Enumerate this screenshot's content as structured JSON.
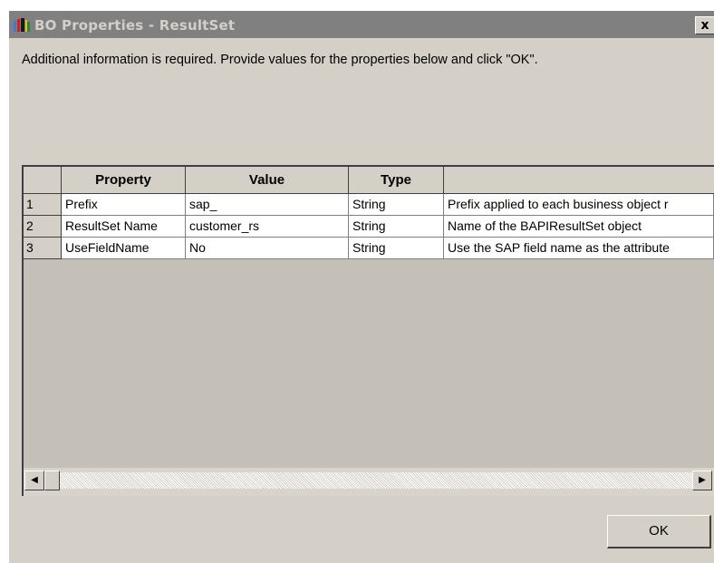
{
  "window": {
    "title": "BO Properties - ResultSet",
    "close_label": "x"
  },
  "instructions": "Additional information is required. Provide values for the properties below and click \"OK\".",
  "grid": {
    "headers": [
      "Property",
      "Value",
      "Type",
      ""
    ],
    "rows": [
      {
        "num": "1",
        "property": "Prefix",
        "value": "sap_",
        "type": "String",
        "description": "Prefix applied to each business object r"
      },
      {
        "num": "2",
        "property": "ResultSet Name",
        "value": "customer_rs",
        "type": "String",
        "description": "Name of the BAPIResultSet object"
      },
      {
        "num": "3",
        "property": "UseFieldName",
        "value": "No",
        "type": "String",
        "description": "Use the SAP field name as the attribute"
      }
    ]
  },
  "scrollbar": {
    "left_arrow": "◀",
    "right_arrow": "▶"
  },
  "ok_button": "OK",
  "icons": {
    "app": "bo-properties-icon",
    "close": "close-icon"
  }
}
